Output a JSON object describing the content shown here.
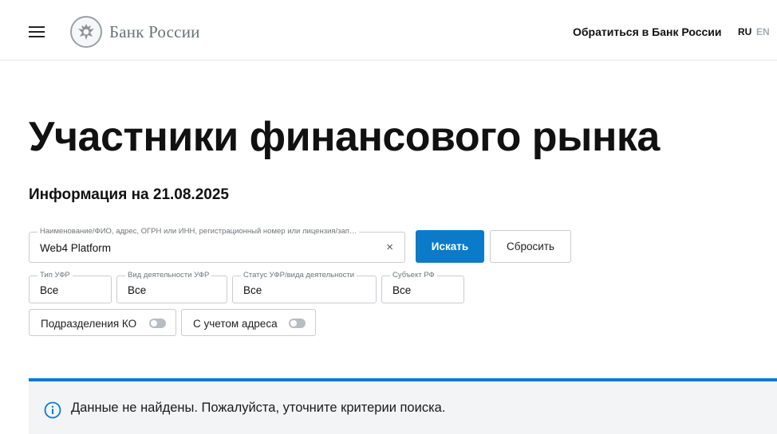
{
  "header": {
    "brand_name": "Банк России",
    "contact_link": "Обратиться в Банк России",
    "lang_ru": "RU",
    "lang_en": "EN"
  },
  "main": {
    "title": "Участники финансового рынка",
    "info_date": "Информация на 21.08.2025"
  },
  "search": {
    "label": "Наименование/ФИО, адрес, ОГРН или ИНН, регистрационный номер или лицензия/зап…",
    "value": "Web4 Platform",
    "clear_symbol": "×",
    "search_button": "Искать",
    "reset_button": "Сбросить"
  },
  "filters": [
    {
      "label": "Тип УФР",
      "value": "Все"
    },
    {
      "label": "Вид деятельности УФР",
      "value": "Все"
    },
    {
      "label": "Статус УФР/вида деятельности",
      "value": "Все"
    },
    {
      "label": "Субъект РФ",
      "value": "Все"
    }
  ],
  "toggles": [
    {
      "label": "Подразделения КО",
      "on": false
    },
    {
      "label": "С учетом адреса",
      "on": false
    }
  ],
  "alert": {
    "text": "Данные не найдены. Пожалуйста, уточните критерии поиска.",
    "icon": "info-circle-icon"
  },
  "colors": {
    "accent": "#0b7bc9",
    "alert_bg": "#f3f4f5",
    "brand_gray": "#6b7075"
  }
}
